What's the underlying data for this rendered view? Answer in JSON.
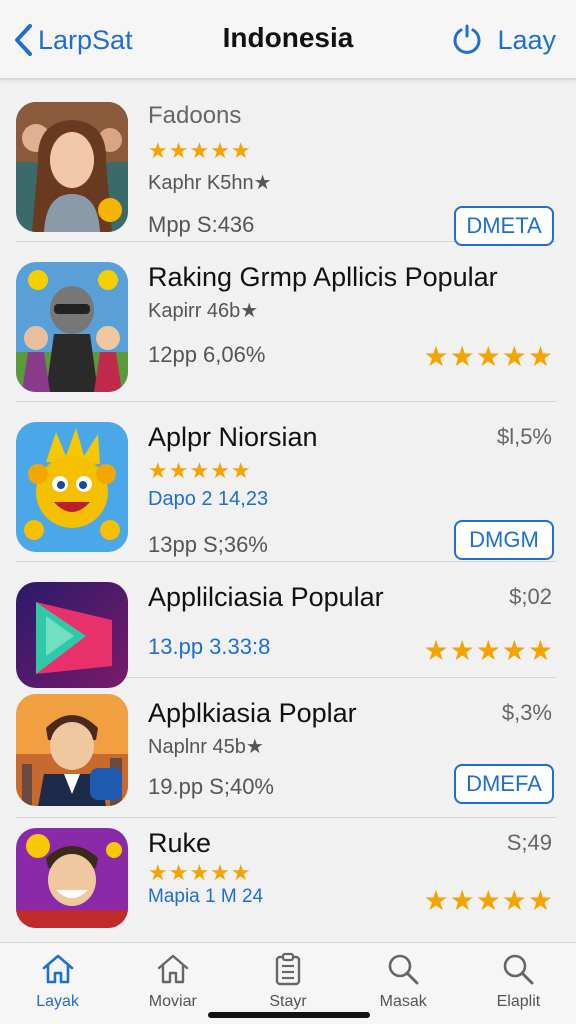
{
  "nav": {
    "back_label": "LarpSat",
    "title": "Indonesia",
    "right_label": "Laay"
  },
  "apps": [
    {
      "title": "Fadoons",
      "stars": "★★★★★",
      "sub": "Kaphr K5hn★",
      "meta": "Mpp S:436",
      "button": "DMETA"
    },
    {
      "title": "Raking Grmp Apllicis Popular",
      "sub": "Kapirr 46b★",
      "meta": "12pp 6,06%",
      "stars": "★★★★★"
    },
    {
      "title": "Aplpr Niorsian",
      "price": "$l,5%",
      "stars": "★★★★★",
      "sub": "Dapo 2 14,23",
      "meta": "13pp S;36%",
      "button": "DMGM"
    },
    {
      "title": "Applilciasia Popular",
      "price": "$;02",
      "meta": "13.pp 3.33:8",
      "stars": "★★★★★"
    },
    {
      "title": "Apþlkiasia Poplar",
      "price": "$,3%",
      "sub": "Naplnr 45b★",
      "meta": "19.pp S;40%",
      "button": "DMEFA"
    },
    {
      "title": "Ruke",
      "price": "S;49",
      "stars": "★★★★★",
      "meta": "Mapia 1 M 24",
      "stars2": "★★★★★"
    }
  ],
  "tabs": [
    {
      "label": "Layak",
      "icon": "home-icon"
    },
    {
      "label": "Moviar",
      "icon": "home-icon"
    },
    {
      "label": "Stayr",
      "icon": "clipboard-icon"
    },
    {
      "label": "Masak",
      "icon": "search-icon"
    },
    {
      "label": "Elaplit",
      "icon": "search-icon"
    }
  ],
  "colors": {
    "accent": "#1e6fd0",
    "star": "#f5a300"
  }
}
